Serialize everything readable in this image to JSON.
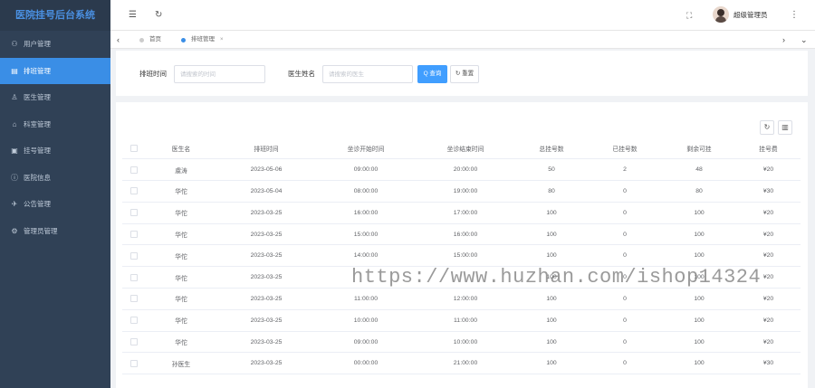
{
  "app": {
    "title": "医院挂号后台系统"
  },
  "sidebar": {
    "items": [
      {
        "icon": "users-icon",
        "glyph": "⚇",
        "label": "用户管理",
        "active": false
      },
      {
        "icon": "schedule-icon",
        "glyph": "▤",
        "label": "排班管理",
        "active": true
      },
      {
        "icon": "doctor-icon",
        "glyph": "♙",
        "label": "医生管理",
        "active": false
      },
      {
        "icon": "department-icon",
        "glyph": "⌂",
        "label": "科室管理",
        "active": false
      },
      {
        "icon": "registration-icon",
        "glyph": "▣",
        "label": "挂号管理",
        "active": false
      },
      {
        "icon": "info-icon",
        "glyph": "ⓘ",
        "label": "医院信息",
        "active": false
      },
      {
        "icon": "notice-icon",
        "glyph": "✈",
        "label": "公告管理",
        "active": false
      },
      {
        "icon": "settings-icon",
        "glyph": "⚙",
        "label": "管理员管理",
        "active": false
      }
    ]
  },
  "header": {
    "menu_glyph": "☰",
    "refresh_glyph": "↻",
    "fullscreen_glyph": "⛶",
    "user_name": "超级管理员",
    "more_glyph": "⋮"
  },
  "tabs": {
    "items": [
      {
        "label": "首页",
        "active": false
      },
      {
        "label": "排班管理",
        "active": true
      }
    ],
    "close_glyph": "×",
    "prev_glyph": "‹",
    "next_glyph": "›",
    "dropdown_glyph": "⌄"
  },
  "search": {
    "date_label": "排班时间",
    "date_placeholder": "请搜索的时间",
    "doctor_label": "医生姓名",
    "doctor_placeholder": "请搜索的医生",
    "search_button": "Q 查询",
    "reset_button": "↻ 重置"
  },
  "toolbar": {
    "refresh_glyph": "↻",
    "columns_glyph": "▥"
  },
  "table": {
    "columns": [
      "医生名",
      "排班时间",
      "坐诊开始时间",
      "坐诊结束时间",
      "总挂号数",
      "已挂号数",
      "剩余可挂",
      "挂号费"
    ],
    "rows": [
      [
        "虞涛",
        "2023-05-06",
        "09:00:00",
        "20:00:00",
        "50",
        "2",
        "48",
        "¥20"
      ],
      [
        "华佗",
        "2023-05-04",
        "08:00:00",
        "19:00:00",
        "80",
        "0",
        "80",
        "¥30"
      ],
      [
        "华佗",
        "2023-03-25",
        "16:00:00",
        "17:00:00",
        "100",
        "0",
        "100",
        "¥20"
      ],
      [
        "华佗",
        "2023-03-25",
        "15:00:00",
        "16:00:00",
        "100",
        "0",
        "100",
        "¥20"
      ],
      [
        "华佗",
        "2023-03-25",
        "14:00:00",
        "15:00:00",
        "100",
        "0",
        "100",
        "¥20"
      ],
      [
        "华佗",
        "2023-03-25",
        "",
        "",
        "100",
        "0",
        "100",
        "¥20"
      ],
      [
        "华佗",
        "2023-03-25",
        "11:00:00",
        "12:00:00",
        "100",
        "0",
        "100",
        "¥20"
      ],
      [
        "华佗",
        "2023-03-25",
        "10:00:00",
        "11:00:00",
        "100",
        "0",
        "100",
        "¥20"
      ],
      [
        "华佗",
        "2023-03-25",
        "09:00:00",
        "10:00:00",
        "100",
        "0",
        "100",
        "¥20"
      ],
      [
        "孙医生",
        "2023-03-25",
        "00:00:00",
        "21:00:00",
        "100",
        "0",
        "100",
        "¥30"
      ]
    ]
  },
  "watermark": "https://www.huzhan.com/ishop14324",
  "colors": {
    "sidebar_bg": "#304156",
    "accent": "#409eff",
    "logo_text": "#4a90e2"
  }
}
